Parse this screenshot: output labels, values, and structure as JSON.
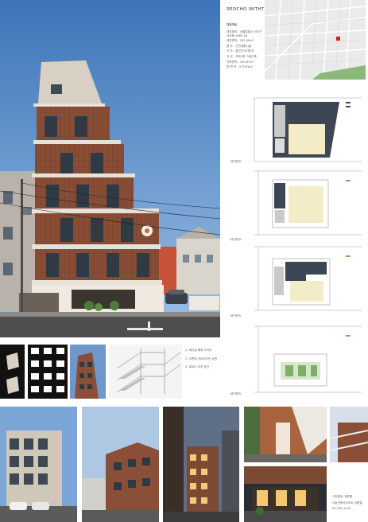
{
  "project": {
    "title": "SEOCHO WITHTOWN",
    "overview_heading": "건축개요",
    "overview": [
      "대지위치 : 서울특별시 서초구",
      "          서초동 1662-16",
      "대지면적 : 252.00m²",
      "용    도 : 근린생활시설",
      "구    조 : 철근콘크리트조",
      "규    모 : 지하1층, 지상7층",
      "건축면적 : 150.67m²",
      "연 면 적 : 973.61m²"
    ]
  },
  "plans": [
    {
      "label": "1층 평면도"
    },
    {
      "label": "2층 평면도"
    },
    {
      "label": "3층 평면도"
    },
    {
      "label": "4층 평면도"
    }
  ],
  "diagram_notes": [
    "1. 계단실 배치 다이어",
    "2. 주변과 어우러지는 입면",
    "3. 발코니 녹지 공간"
  ],
  "credits": [
    "사진촬영: 윤준환",
    "나눔건축사사무소 이병철",
    "02-784-1100"
  ],
  "icons": {
    "map_marker": "red-square-marker",
    "north_arrow": "north-arrow-icon"
  },
  "colors": {
    "brick": "#8a4e36",
    "sky": "#5a8ec8",
    "concrete": "#d4cdc1",
    "marker": "#d0202a"
  }
}
